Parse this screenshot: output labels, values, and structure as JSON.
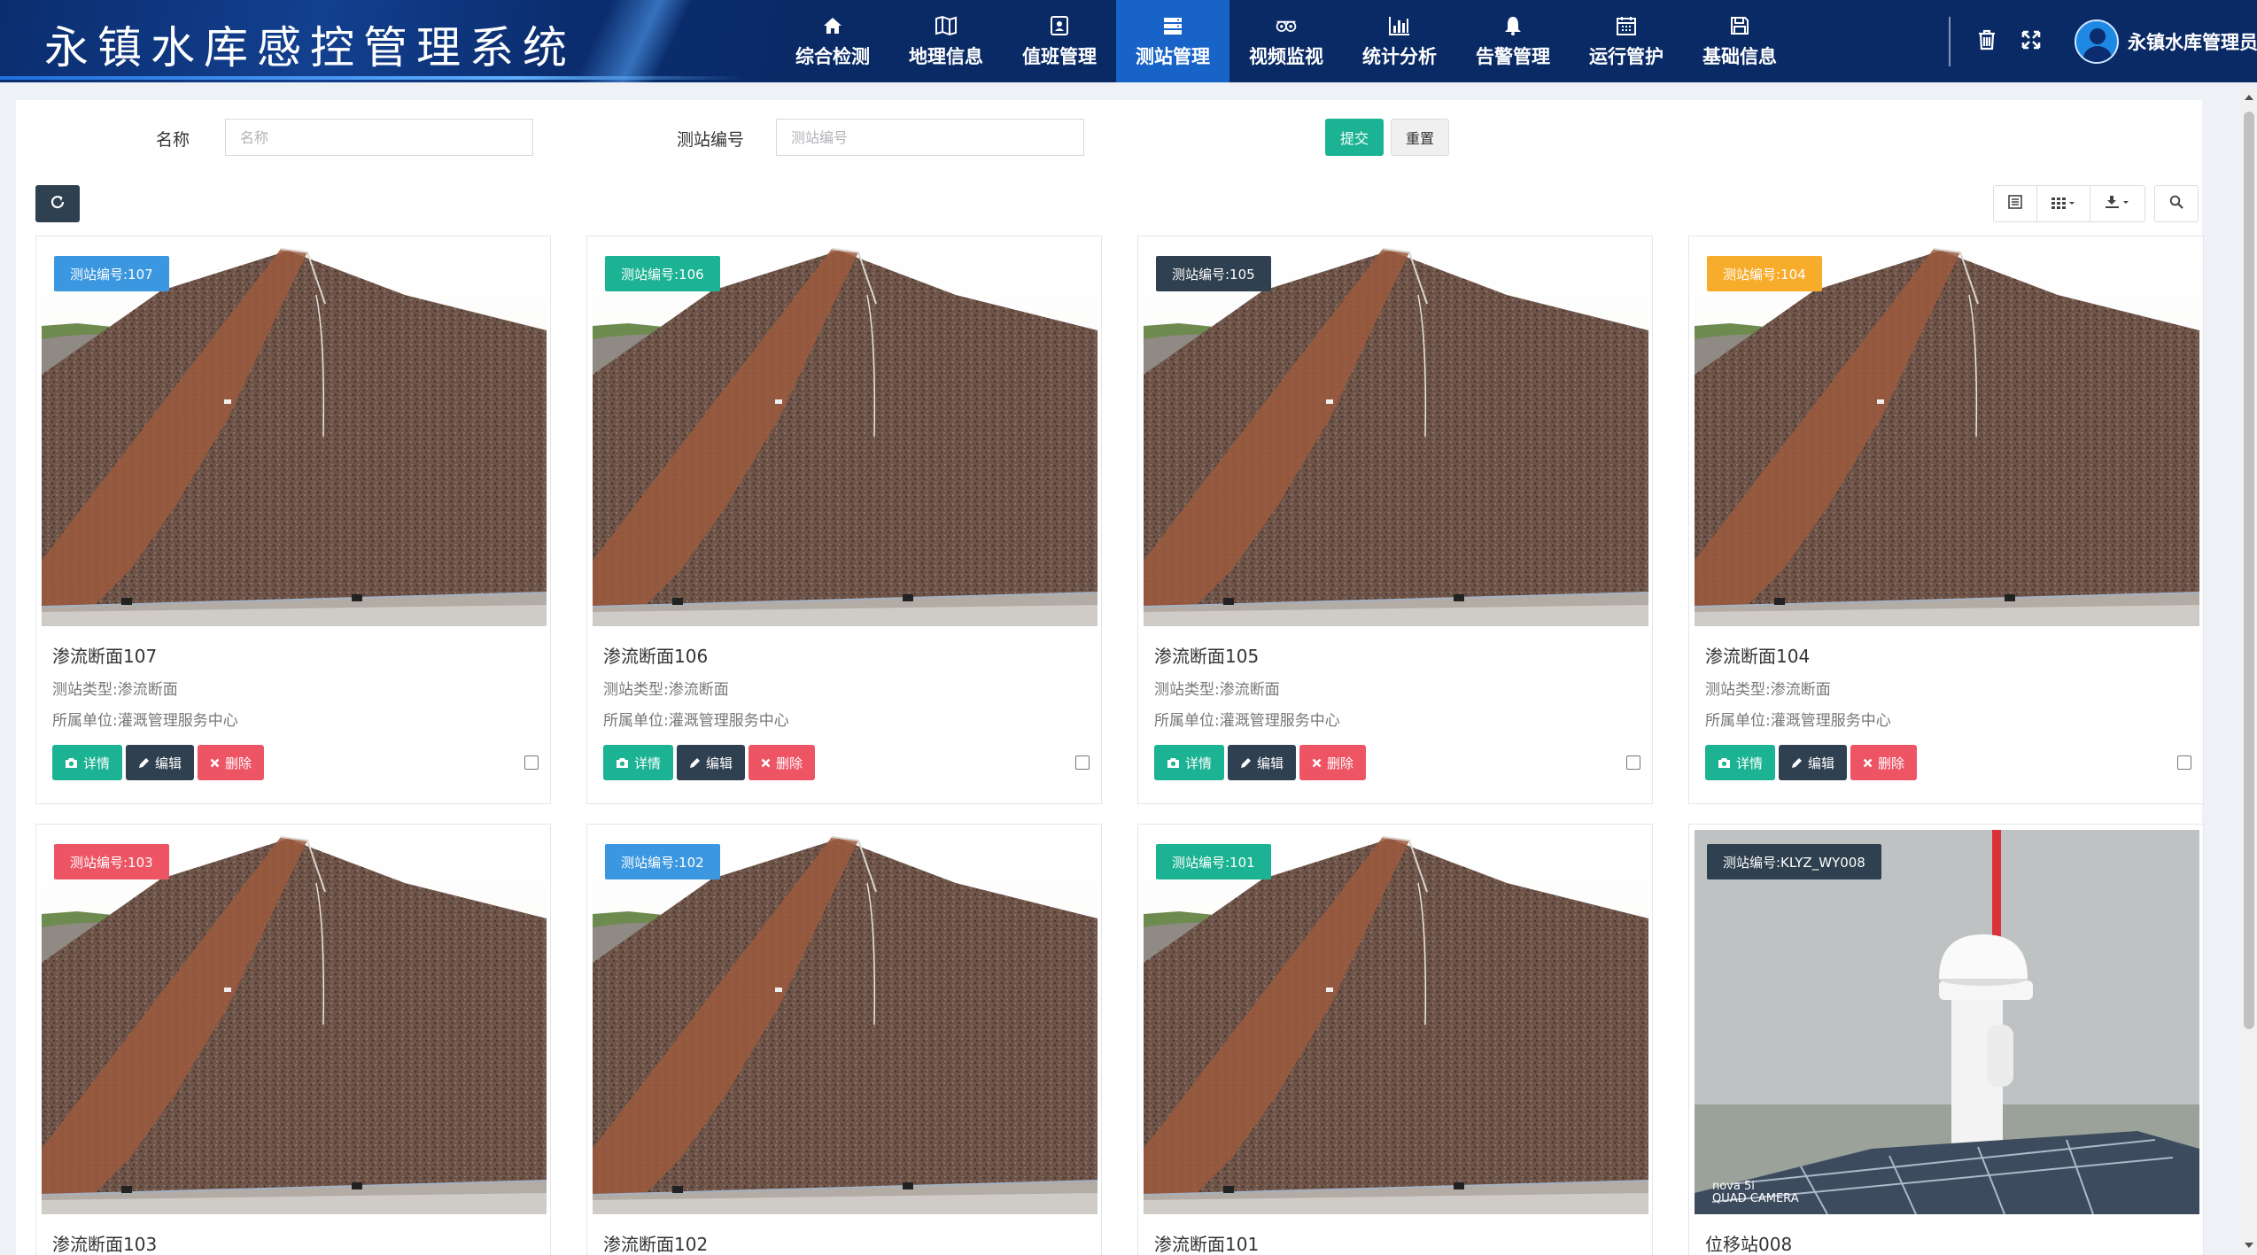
{
  "header": {
    "title": "永镇水库感控管理系统",
    "user": "永镇水库管理员",
    "nav": [
      {
        "label": "综合检测",
        "icon": "home-icon",
        "active": false
      },
      {
        "label": "地理信息",
        "icon": "map-icon",
        "active": false
      },
      {
        "label": "值班管理",
        "icon": "contact-card-icon",
        "active": false
      },
      {
        "label": "测站管理",
        "icon": "server-icon",
        "active": true
      },
      {
        "label": "视频监视",
        "icon": "camera-icon",
        "active": false
      },
      {
        "label": "统计分析",
        "icon": "bar-chart-icon",
        "active": false
      },
      {
        "label": "告警管理",
        "icon": "bell-icon",
        "active": false
      },
      {
        "label": "运行管护",
        "icon": "calendar-icon",
        "active": false
      },
      {
        "label": "基础信息",
        "icon": "save-icon",
        "active": false
      }
    ]
  },
  "search": {
    "name_label": "名称",
    "name_placeholder": "名称",
    "code_label": "测站编号",
    "code_placeholder": "测站编号",
    "submit": "提交",
    "reset": "重置"
  },
  "colors": {
    "header_bg": "#0a2a66",
    "nav_active": "#1763c7",
    "green": "#1cb394",
    "dark": "#2f4050",
    "red": "#ed5565",
    "blue": "#3b98e0",
    "orange": "#f8ac2c"
  },
  "card_actions": {
    "detail": "详情",
    "edit": "编辑",
    "delete": "删除"
  },
  "cards": [
    {
      "badge": "测站编号:107",
      "badge_color": "#3b98e0",
      "title": "渗流断面107",
      "type": "测站类型:渗流断面",
      "unit": "所属单位:灌溉管理服务中心",
      "image": "dam-slope"
    },
    {
      "badge": "测站编号:106",
      "badge_color": "#1cb394",
      "title": "渗流断面106",
      "type": "测站类型:渗流断面",
      "unit": "所属单位:灌溉管理服务中心",
      "image": "dam-slope"
    },
    {
      "badge": "测站编号:105",
      "badge_color": "#2f4050",
      "title": "渗流断面105",
      "type": "测站类型:渗流断面",
      "unit": "所属单位:灌溉管理服务中心",
      "image": "dam-slope"
    },
    {
      "badge": "测站编号:104",
      "badge_color": "#f8ac2c",
      "title": "渗流断面104",
      "type": "测站类型:渗流断面",
      "unit": "所属单位:灌溉管理服务中心",
      "image": "dam-slope"
    },
    {
      "badge": "测站编号:103",
      "badge_color": "#ed5565",
      "title": "渗流断面103",
      "image": "dam-slope"
    },
    {
      "badge": "测站编号:102",
      "badge_color": "#3b98e0",
      "title": "渗流断面102",
      "image": "dam-slope"
    },
    {
      "badge": "测站编号:101",
      "badge_color": "#1cb394",
      "title": "渗流断面101",
      "image": "dam-slope"
    },
    {
      "badge": "测站编号:KLYZ_WY008",
      "badge_color": "#2f4050",
      "title": "位移站008",
      "image": "gnss-station",
      "watermark": "nova 5i\nQUAD CAMERA"
    }
  ]
}
